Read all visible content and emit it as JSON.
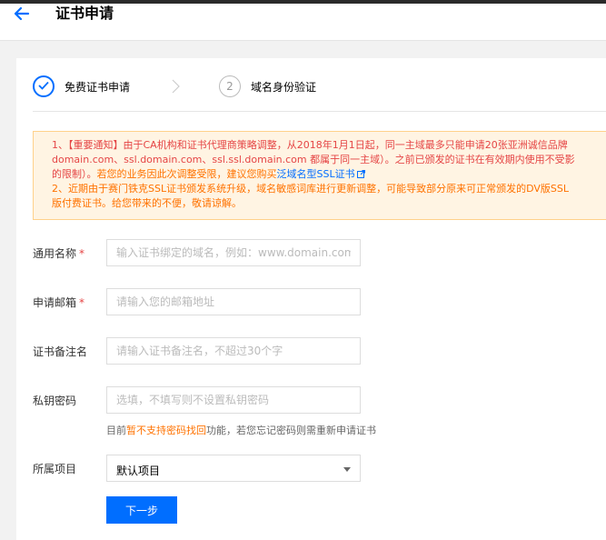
{
  "header": {
    "title": "证书申请"
  },
  "steps": [
    {
      "number": "✓",
      "label": "免费证书申请",
      "state": "active"
    },
    {
      "number": "2",
      "label": "域名身份验证",
      "state": "pending"
    }
  ],
  "notice": {
    "line1_prefix": "1、【重要通知】由于CA机构和证书代理商策略调整，从2018年1月1日起，同一主域最多只能申请20张亚洲诚信品牌",
    "line2": "domain.com、ssl.domain.com、ssl.ssl.domain.com 都属于同一主域）。之前已颁发的证书在有效期内使用不受影",
    "line3_red": "的限制）。",
    "line3_orange": "若您的业务因此次调整受限，建议您购买",
    "line3_link": "泛域名型SSL证书",
    "line4": "2、近期由于赛门铁克SSL证书颁发系统升级，域名敏感词库进行更新调整，可能导致部分原来可正常颁发的DV版SSL",
    "line5": "版付费证书。给您带来的不便，敬请谅解。"
  },
  "form": {
    "common_name": {
      "label": "通用名称",
      "placeholder": "输入证书绑定的域名，例如：www.domain.com"
    },
    "email": {
      "label": "申请邮箱",
      "placeholder": "请输入您的邮箱地址"
    },
    "remark": {
      "label": "证书备注名",
      "placeholder": "请输入证书备注名，不超过30个字"
    },
    "private_key_password": {
      "label": "私钥密码",
      "placeholder": "选填，不填写则不设置私钥密码"
    },
    "hint_prefix": "目前",
    "hint_warn": "暂不支持密码找回",
    "hint_suffix": "功能，若您忘记密码则需重新申请证书",
    "project": {
      "label": "所属项目",
      "value": "默认项目"
    },
    "required_mark": "*",
    "next_button": "下一步"
  },
  "colors": {
    "primary": "#006eff",
    "error_red": "#e54545",
    "warning_orange": "#ff7200",
    "notice_bg": "#fff4e3"
  },
  "icons": [
    "back-arrow-icon",
    "check-icon",
    "step-chevron-icon",
    "external-link-icon",
    "dropdown-caret-icon"
  ]
}
